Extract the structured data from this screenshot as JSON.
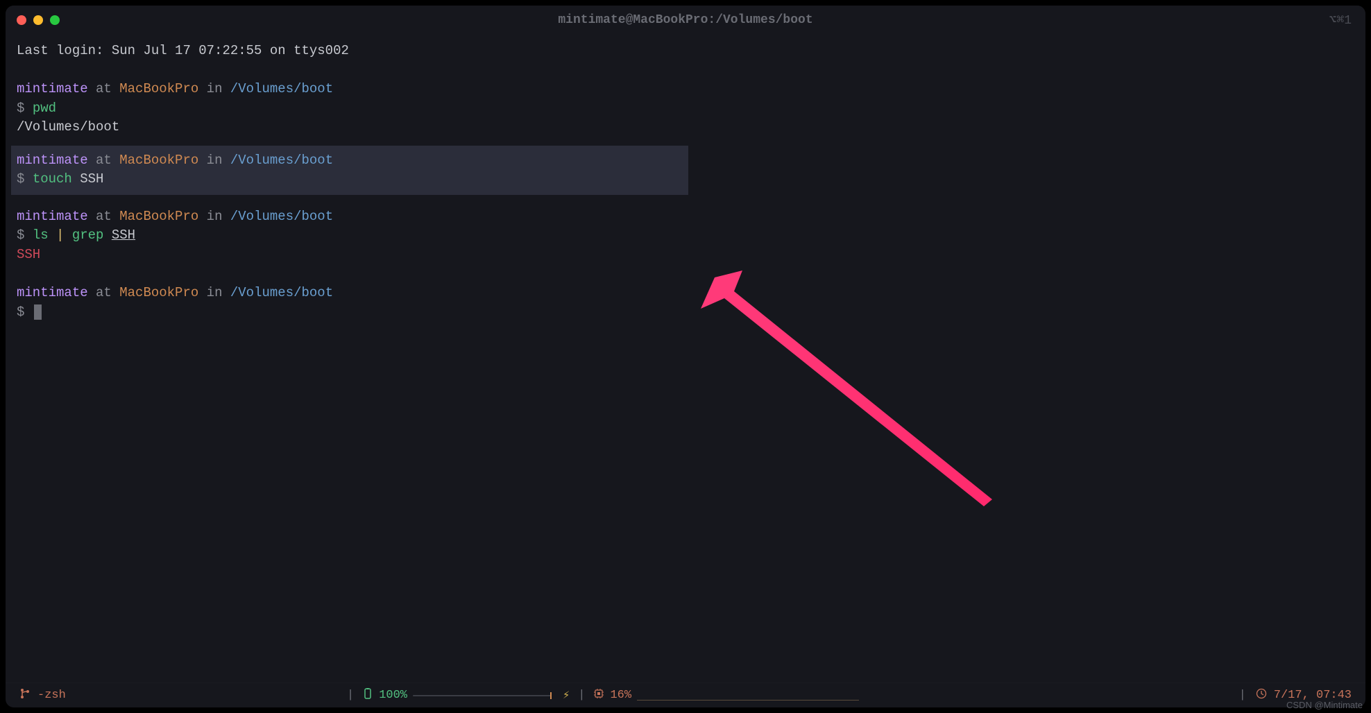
{
  "window": {
    "title": "mintimate@MacBookPro:/Volumes/boot",
    "shortcut": "⌥⌘1"
  },
  "terminal": {
    "last_login": "Last login: Sun Jul 17 07:22:55 on ttys002",
    "prompts": [
      {
        "user": "mintimate",
        "at": " at ",
        "host": "MacBookPro",
        "in": " in ",
        "path": "/Volumes/boot"
      }
    ],
    "prompt_symbol": "$",
    "cmd_pwd": "pwd",
    "out_pwd": "/Volumes/boot",
    "cmd_touch": "touch",
    "cmd_touch_arg": "SSH",
    "cmd_ls": "ls",
    "cmd_pipe": "|",
    "cmd_grep": "grep",
    "cmd_grep_arg": "SSH",
    "out_grep": "SSH"
  },
  "status": {
    "shell": "-zsh",
    "battery": "100%",
    "cpu": "16%",
    "time": "7/17, 07:43"
  },
  "watermark": "CSDN @Mintimate"
}
